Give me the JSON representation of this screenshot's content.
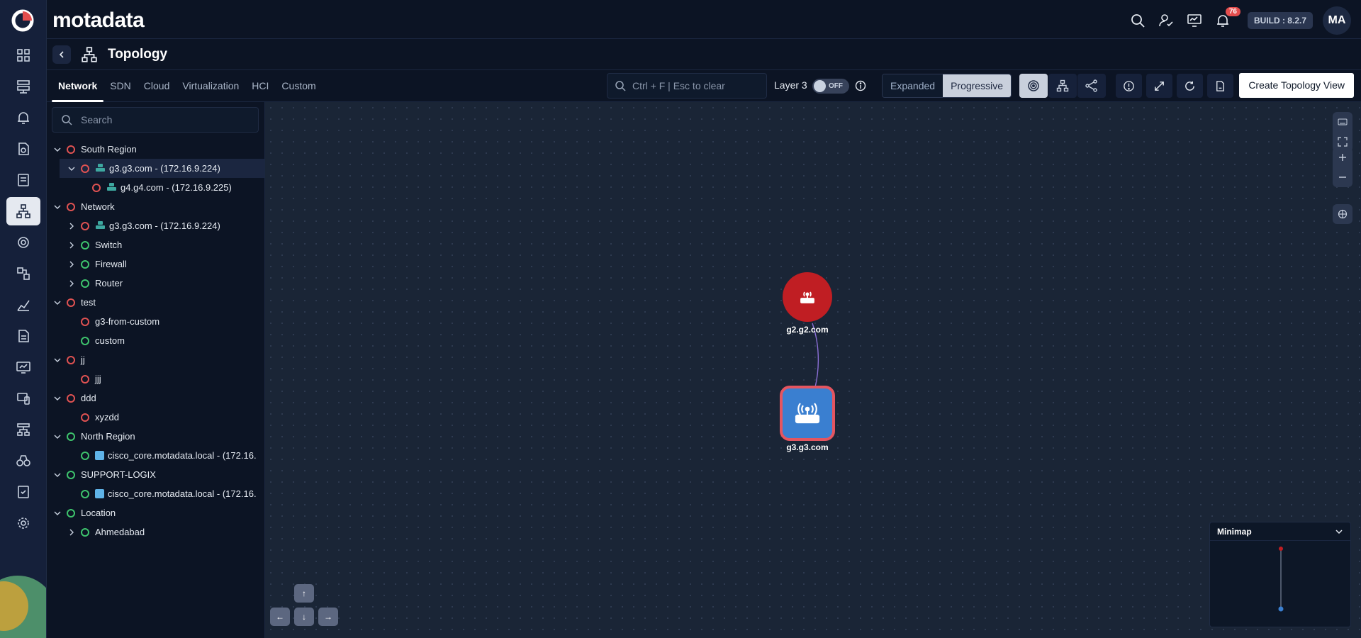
{
  "brand": {
    "name": "motadata"
  },
  "header": {
    "build": "BUILD : 8.2.7",
    "notifications_count": "76",
    "avatar_initials": "MA"
  },
  "page": {
    "title": "Topology"
  },
  "tabs": [
    {
      "label": "Network",
      "active": true
    },
    {
      "label": "SDN"
    },
    {
      "label": "Cloud"
    },
    {
      "label": "Virtualization"
    },
    {
      "label": "HCI"
    },
    {
      "label": "Custom"
    }
  ],
  "toolbar": {
    "search_placeholder": "Ctrl + F | Esc to clear",
    "layer_label": "Layer 3",
    "toggle_text": "OFF",
    "mode_expanded": "Expanded",
    "mode_progressive": "Progressive",
    "create_label": "Create Topology View"
  },
  "sidebar": {
    "search_placeholder": "Search",
    "tree": [
      {
        "label": "South Region",
        "status": "red",
        "expanded": true,
        "level": 0
      },
      {
        "label": "g3.g3.com - (172.16.9.224)",
        "status": "red",
        "expanded": true,
        "level": 1,
        "icon": "device",
        "selected": true
      },
      {
        "label": "g4.g4.com - (172.16.9.225)",
        "status": "red",
        "level": 2,
        "icon": "device"
      },
      {
        "label": "Network",
        "status": "red",
        "expanded": true,
        "level": 0
      },
      {
        "label": "g3.g3.com - (172.16.9.224)",
        "status": "red",
        "collapsed": true,
        "level": 1,
        "icon": "device"
      },
      {
        "label": "Switch",
        "status": "green",
        "collapsed": true,
        "level": 1
      },
      {
        "label": "Firewall",
        "status": "green",
        "collapsed": true,
        "level": 1
      },
      {
        "label": "Router",
        "status": "green",
        "collapsed": true,
        "level": 1
      },
      {
        "label": "test",
        "status": "red",
        "expanded": true,
        "level": 0
      },
      {
        "label": "g3-from-custom",
        "status": "red",
        "level": 1
      },
      {
        "label": "custom",
        "status": "green",
        "level": 1
      },
      {
        "label": "jj",
        "status": "red",
        "expanded": true,
        "level": 0
      },
      {
        "label": "jjj",
        "status": "red",
        "level": 1
      },
      {
        "label": "ddd",
        "status": "red",
        "expanded": true,
        "level": 0
      },
      {
        "label": "xyzdd",
        "status": "red",
        "level": 1
      },
      {
        "label": "North Region",
        "status": "green",
        "expanded": true,
        "level": 0
      },
      {
        "label": "cisco_core.motadata.local - (172.16.",
        "status": "green",
        "level": 1,
        "icon": "cisco"
      },
      {
        "label": "SUPPORT-LOGIX",
        "status": "green",
        "expanded": true,
        "level": 0
      },
      {
        "label": "cisco_core.motadata.local - (172.16.",
        "status": "green",
        "level": 1,
        "icon": "cisco"
      },
      {
        "label": "Location",
        "status": "green",
        "expanded": true,
        "level": 0
      },
      {
        "label": "Ahmedabad",
        "status": "green",
        "collapsed": true,
        "level": 1
      }
    ]
  },
  "canvas": {
    "nodes": [
      {
        "label": "g2.g2.com",
        "color": "#c01e23",
        "icon": "router-icon"
      },
      {
        "label": "g3.g3.com",
        "color": "#3a7fd0",
        "icon": "router-icon"
      }
    ],
    "minimap_title": "Minimap"
  }
}
